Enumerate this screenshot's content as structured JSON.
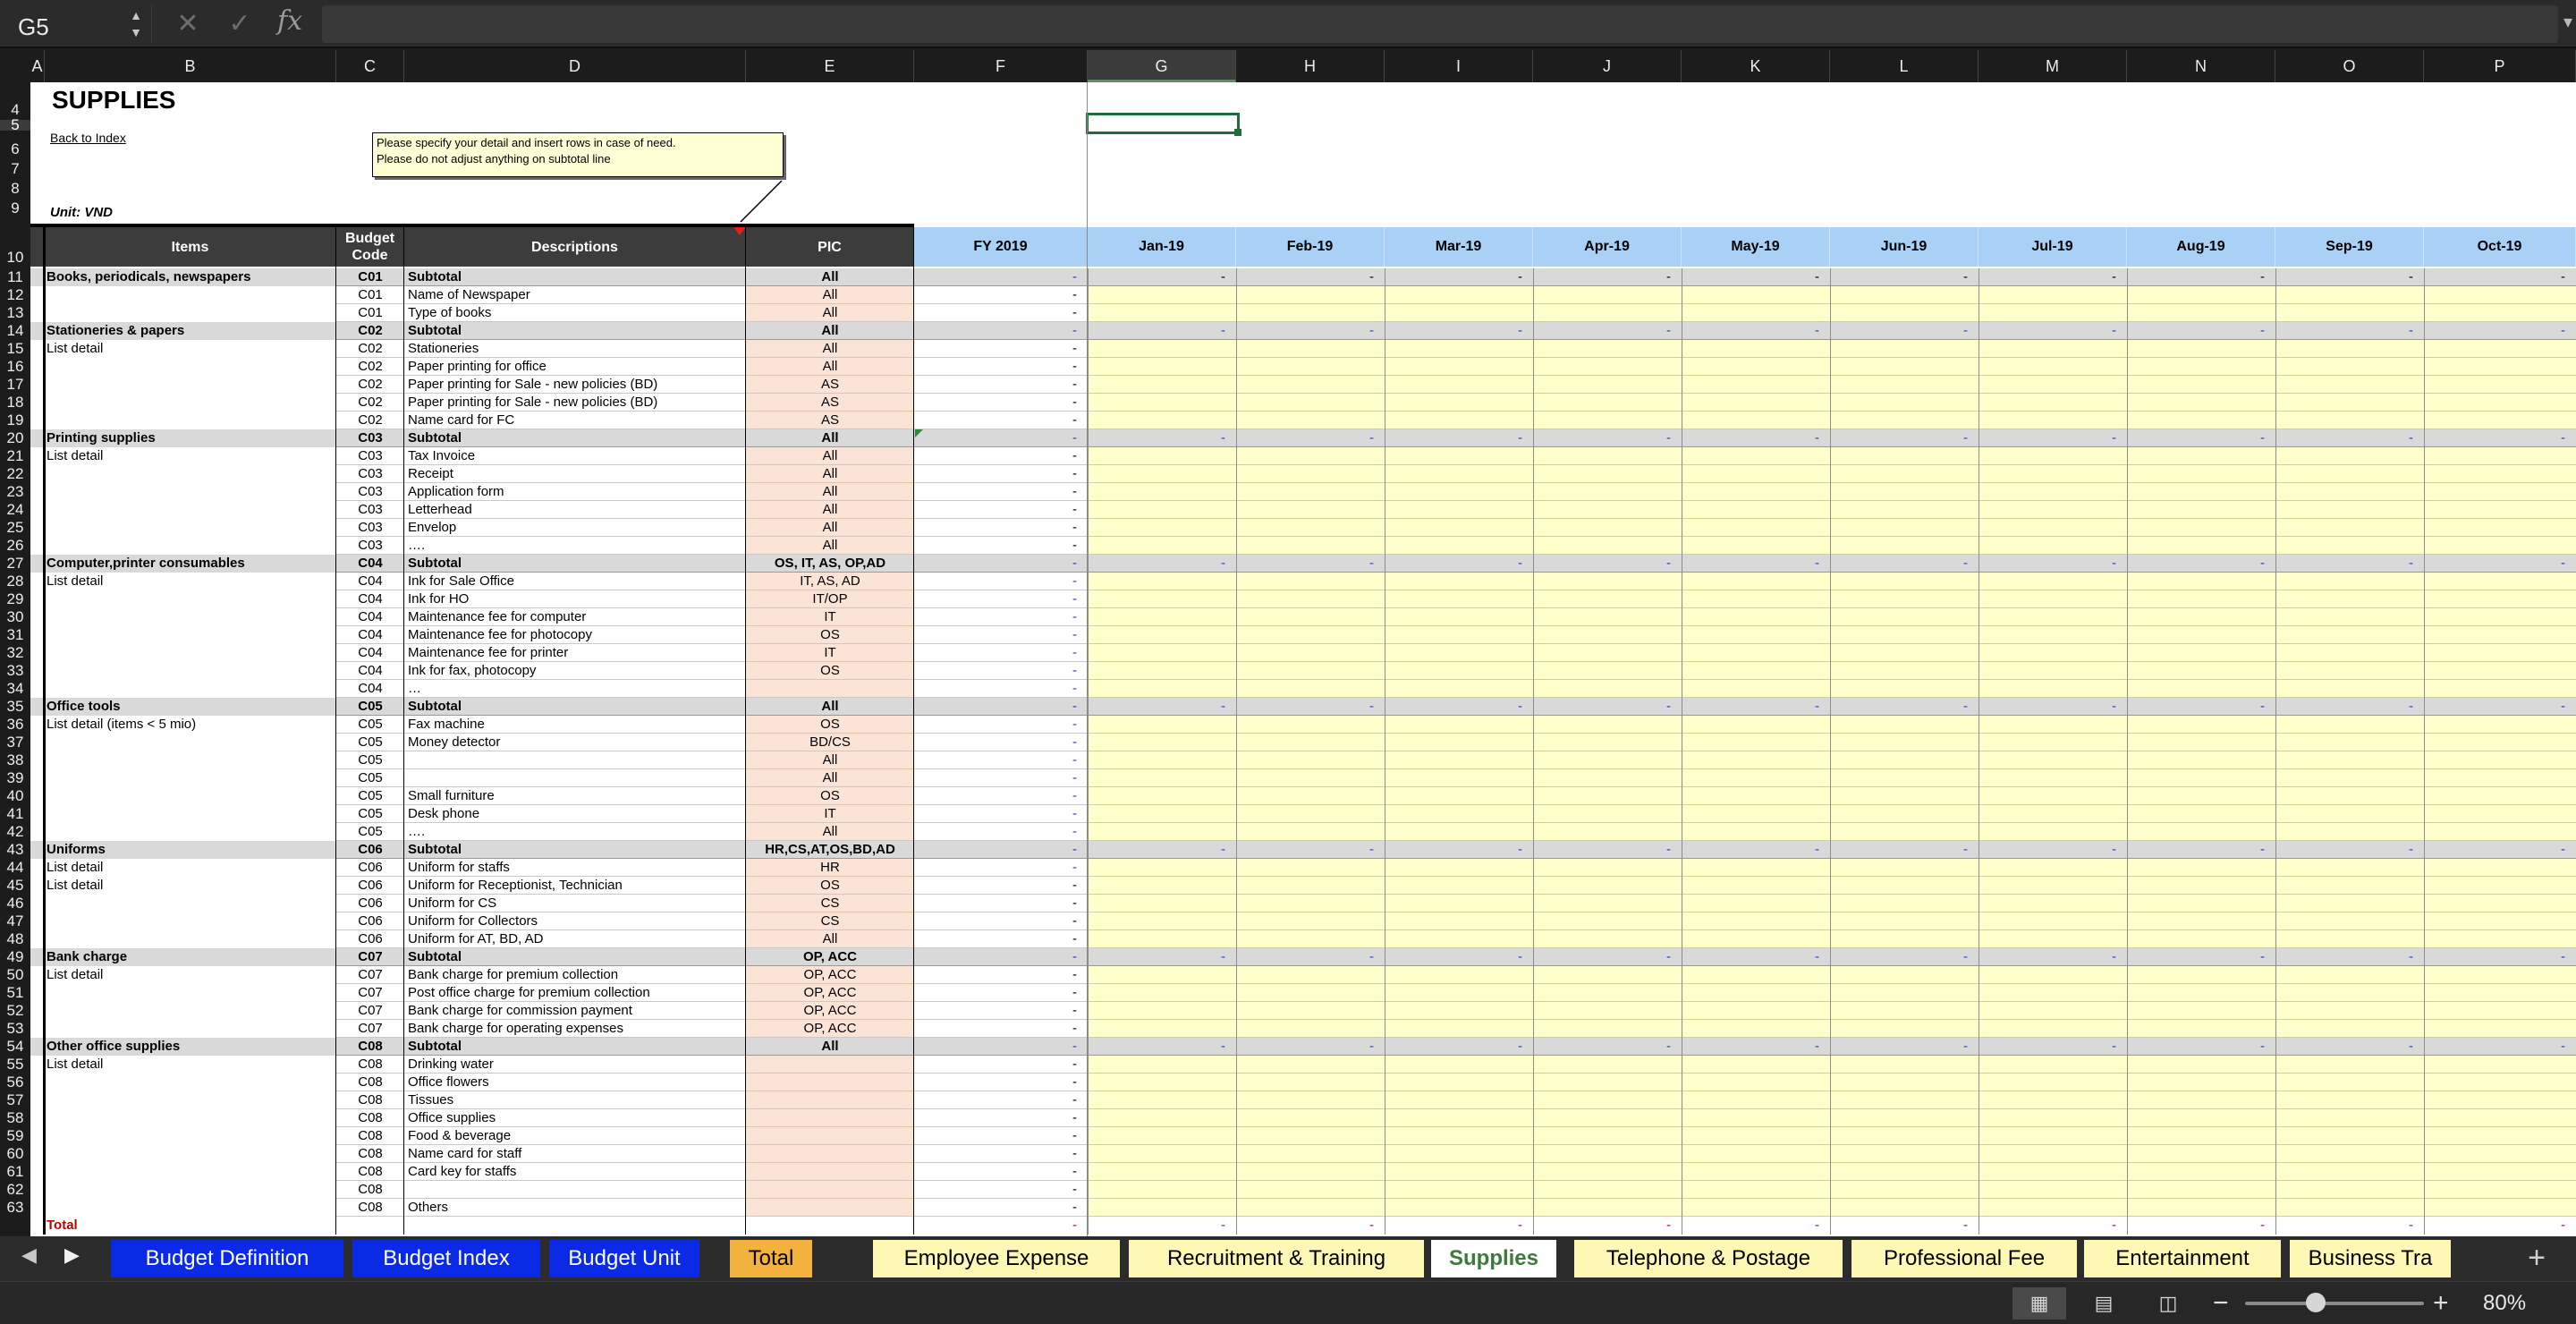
{
  "formula_bar": {
    "name_box": "G5",
    "cancel_icon": "✕",
    "enter_icon": "✓",
    "fx_label": "fx",
    "formula": ""
  },
  "columns": [
    "A",
    "B",
    "C",
    "D",
    "E",
    "F",
    "G",
    "H",
    "I",
    "J",
    "K",
    "L",
    "M",
    "N",
    "O",
    "P"
  ],
  "selected_column": "G",
  "selected_row": "5",
  "sheet": {
    "title": "SUPPLIES",
    "back_link": "Back to Index",
    "note_line1": "Please specify your detail and insert rows in case of need.",
    "note_line2": "Please do not adjust anything on subtotal line",
    "unit": "Unit: VND",
    "headers": {
      "items": "Items",
      "budget_code": "Budget Code",
      "descriptions": "Descriptions",
      "pic": "PIC",
      "fy": "FY 2019"
    },
    "months": [
      "Jan-19",
      "Feb-19",
      "Mar-19",
      "Apr-19",
      "May-19",
      "Jun-19",
      "Jul-19",
      "Aug-19",
      "Sep-19",
      "Oct-19"
    ],
    "rows": [
      {
        "n": "11",
        "item": "Books, periodicals, newspapers",
        "code": "C01",
        "desc": "Subtotal",
        "pic": "All",
        "sub": true
      },
      {
        "n": "12",
        "item": "",
        "code": "C01",
        "desc": "Name of Newspaper",
        "pic": "All"
      },
      {
        "n": "13",
        "item": "",
        "code": "C01",
        "desc": "Type of books",
        "pic": "All"
      },
      {
        "n": "14",
        "item": "Stationeries & papers",
        "code": "C02",
        "desc": "Subtotal",
        "pic": "All",
        "sub": true
      },
      {
        "n": "15",
        "item": "List detail",
        "code": "C02",
        "desc": "Stationeries",
        "pic": "All"
      },
      {
        "n": "16",
        "item": "",
        "code": "C02",
        "desc": "Paper printing for office",
        "pic": "All"
      },
      {
        "n": "17",
        "item": "",
        "code": "C02",
        "desc": "Paper printing for Sale - new policies (BD)",
        "pic": "AS"
      },
      {
        "n": "18",
        "item": "",
        "code": "C02",
        "desc": "Paper printing for Sale - new policies (BD)",
        "pic": "AS"
      },
      {
        "n": "19",
        "item": "",
        "code": "C02",
        "desc": "Name card for FC",
        "pic": "AS"
      },
      {
        "n": "20",
        "item": "Printing supplies",
        "code": "C03",
        "desc": "Subtotal",
        "pic": "All",
        "sub": true
      },
      {
        "n": "21",
        "item": "List detail",
        "code": "C03",
        "desc": "Tax Invoice",
        "pic": "All"
      },
      {
        "n": "22",
        "item": "",
        "code": "C03",
        "desc": "Receipt",
        "pic": "All"
      },
      {
        "n": "23",
        "item": "",
        "code": "C03",
        "desc": "Application form",
        "pic": "All"
      },
      {
        "n": "24",
        "item": "",
        "code": "C03",
        "desc": "Letterhead",
        "pic": "All"
      },
      {
        "n": "25",
        "item": "",
        "code": "C03",
        "desc": "Envelop",
        "pic": "All"
      },
      {
        "n": "26",
        "item": "",
        "code": "C03",
        "desc": "….",
        "pic": "All"
      },
      {
        "n": "27",
        "item": "Computer,printer consumables",
        "code": "C04",
        "desc": "Subtotal",
        "pic": "OS, IT, AS, OP,AD",
        "sub": true
      },
      {
        "n": "28",
        "item": "List detail",
        "code": "C04",
        "desc": "Ink for Sale Office",
        "pic": "IT, AS, AD"
      },
      {
        "n": "29",
        "item": "",
        "code": "C04",
        "desc": "Ink for HO",
        "pic": "IT/OP"
      },
      {
        "n": "30",
        "item": "",
        "code": "C04",
        "desc": "Maintenance fee for computer",
        "pic": "IT"
      },
      {
        "n": "31",
        "item": "",
        "code": "C04",
        "desc": "Maintenance fee for photocopy",
        "pic": "OS"
      },
      {
        "n": "32",
        "item": "",
        "code": "C04",
        "desc": "Maintenance fee for printer",
        "pic": "IT"
      },
      {
        "n": "33",
        "item": "",
        "code": "C04",
        "desc": "Ink for fax, photocopy",
        "pic": "OS"
      },
      {
        "n": "34",
        "item": "",
        "code": "C04",
        "desc": "…",
        "pic": ""
      },
      {
        "n": "35",
        "item": "Office tools",
        "code": "C05",
        "desc": "Subtotal",
        "pic": "All",
        "sub": true
      },
      {
        "n": "36",
        "item": "List detail (items < 5 mio)",
        "code": "C05",
        "desc": "Fax machine",
        "pic": "OS"
      },
      {
        "n": "37",
        "item": "",
        "code": "C05",
        "desc": "Money detector",
        "pic": "BD/CS"
      },
      {
        "n": "38",
        "item": "",
        "code": "C05",
        "desc": "",
        "pic": "All"
      },
      {
        "n": "39",
        "item": "",
        "code": "C05",
        "desc": "",
        "pic": "All"
      },
      {
        "n": "40",
        "item": "",
        "code": "C05",
        "desc": "Small furniture",
        "pic": "OS"
      },
      {
        "n": "41",
        "item": "",
        "code": "C05",
        "desc": "Desk phone",
        "pic": "IT"
      },
      {
        "n": "42",
        "item": "",
        "code": "C05",
        "desc": "….",
        "pic": "All"
      },
      {
        "n": "43",
        "item": "Uniforms",
        "code": "C06",
        "desc": "Subtotal",
        "pic": "HR,CS,AT,OS,BD,AD",
        "sub": true
      },
      {
        "n": "44",
        "item": "List detail",
        "code": "C06",
        "desc": "Uniform for staffs",
        "pic": "HR"
      },
      {
        "n": "45",
        "item": "List detail",
        "code": "C06",
        "desc": "Uniform for Receptionist, Technician",
        "pic": "OS"
      },
      {
        "n": "46",
        "item": "",
        "code": "C06",
        "desc": "Uniform for CS",
        "pic": "CS"
      },
      {
        "n": "47",
        "item": "",
        "code": "C06",
        "desc": "Uniform for Collectors",
        "pic": "CS"
      },
      {
        "n": "48",
        "item": "",
        "code": "C06",
        "desc": "Uniform for AT, BD, AD",
        "pic": "All"
      },
      {
        "n": "49",
        "item": "Bank charge",
        "code": "C07",
        "desc": "Subtotal",
        "pic": "OP, ACC",
        "sub": true
      },
      {
        "n": "50",
        "item": "List detail",
        "code": "C07",
        "desc": "Bank charge for premium collection",
        "pic": "OP, ACC"
      },
      {
        "n": "51",
        "item": "",
        "code": "C07",
        "desc": "Post office charge for premium collection",
        "pic": "OP, ACC"
      },
      {
        "n": "52",
        "item": "",
        "code": "C07",
        "desc": "Bank charge for commission payment",
        "pic": "OP, ACC"
      },
      {
        "n": "53",
        "item": "",
        "code": "C07",
        "desc": "Bank charge for operating expenses",
        "pic": "OP, ACC"
      },
      {
        "n": "54",
        "item": "Other office supplies",
        "code": "C08",
        "desc": "Subtotal",
        "pic": "All",
        "sub": true
      },
      {
        "n": "55",
        "item": "List detail",
        "code": "C08",
        "desc": "Drinking water",
        "pic": ""
      },
      {
        "n": "56",
        "item": "",
        "code": "C08",
        "desc": "Office flowers",
        "pic": ""
      },
      {
        "n": "57",
        "item": "",
        "code": "C08",
        "desc": "Tissues",
        "pic": ""
      },
      {
        "n": "58",
        "item": "",
        "code": "C08",
        "desc": "Office supplies",
        "pic": ""
      },
      {
        "n": "59",
        "item": "",
        "code": "C08",
        "desc": "Food & beverage",
        "pic": ""
      },
      {
        "n": "60",
        "item": "",
        "code": "C08",
        "desc": "Name card for staff",
        "pic": ""
      },
      {
        "n": "61",
        "item": "",
        "code": "C08",
        "desc": "Card key for staffs",
        "pic": ""
      },
      {
        "n": "62",
        "item": "",
        "code": "C08",
        "desc": "",
        "pic": ""
      },
      {
        "n": "63",
        "item": "",
        "code": "C08",
        "desc": "Others",
        "pic": ""
      }
    ],
    "total_label": "Total",
    "dash": "-"
  },
  "top_rows": [
    "4",
    "5",
    "6",
    "7",
    "8",
    "9",
    "10"
  ],
  "tabs": [
    {
      "label": "Budget Definition",
      "style": "blue"
    },
    {
      "label": "Budget Index",
      "style": "blue"
    },
    {
      "label": "Budget Unit",
      "style": "blue"
    },
    {
      "label": "Total",
      "style": "orange"
    },
    {
      "label": "Employee Expense",
      "style": "yellow"
    },
    {
      "label": "Recruitment & Training",
      "style": "yellow"
    },
    {
      "label": "Supplies",
      "style": "active"
    },
    {
      "label": "Telephone & Postage",
      "style": "yellow"
    },
    {
      "label": "Professional Fee",
      "style": "yellow"
    },
    {
      "label": "Entertainment",
      "style": "yellow"
    },
    {
      "label": "Business Tra",
      "style": "yellow"
    }
  ],
  "status": {
    "zoom": "80%",
    "minus": "−",
    "plus": "+"
  },
  "colors": {
    "header_dark": "#3c3c3c",
    "month_header": "#a9d0f5",
    "input_yellow": "#ffffcc",
    "pic_pink": "#fbe3d6",
    "subtotal_grey": "#d9d9d9",
    "tab_blue": "#0a2ae6"
  }
}
